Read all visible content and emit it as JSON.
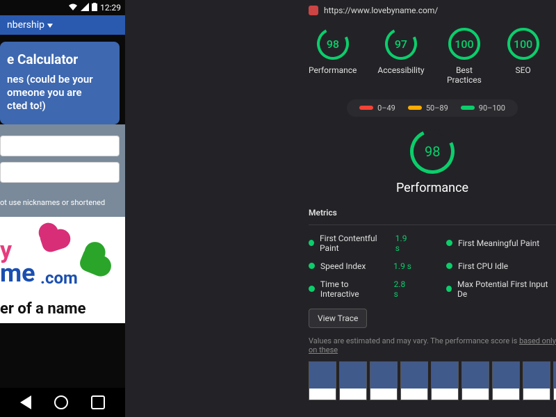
{
  "phone": {
    "status": {
      "time": "12:29"
    },
    "membership_label": "nbership",
    "card": {
      "title": "e Calculator",
      "subtitle": "nes (could be your\nomeone you are\ncted to!)"
    },
    "hint": "ot use nicknames or shortened",
    "logo": {
      "part1": "y",
      "part2": "me",
      "part3": ".com"
    },
    "tagline": "er of a name"
  },
  "lighthouse": {
    "url": "https://www.lovebyname.com/",
    "gauges": [
      {
        "score": "98",
        "label": "Performance"
      },
      {
        "score": "97",
        "label": "Accessibility"
      },
      {
        "score": "100",
        "label": "Best\nPractices"
      },
      {
        "score": "100",
        "label": "SEO"
      }
    ],
    "legend": {
      "low": "0–49",
      "mid": "50–89",
      "high": "90–100"
    },
    "main_gauge": {
      "score": "98",
      "label": "Performance"
    },
    "metrics_header": "Metrics",
    "metrics": {
      "left": [
        {
          "name": "First Contentful Paint",
          "value": "1.9 s"
        },
        {
          "name": "Speed Index",
          "value": "1.9 s"
        },
        {
          "name": "Time to Interactive",
          "value": "2.8 s"
        }
      ],
      "right": [
        {
          "name": "First Meaningful Paint"
        },
        {
          "name": "First CPU Idle"
        },
        {
          "name": "Max Potential First Input De"
        }
      ]
    },
    "view_trace": "View Trace",
    "description": "Values are estimated and may vary. The performance score is ",
    "description_link": "based only on these "
  }
}
